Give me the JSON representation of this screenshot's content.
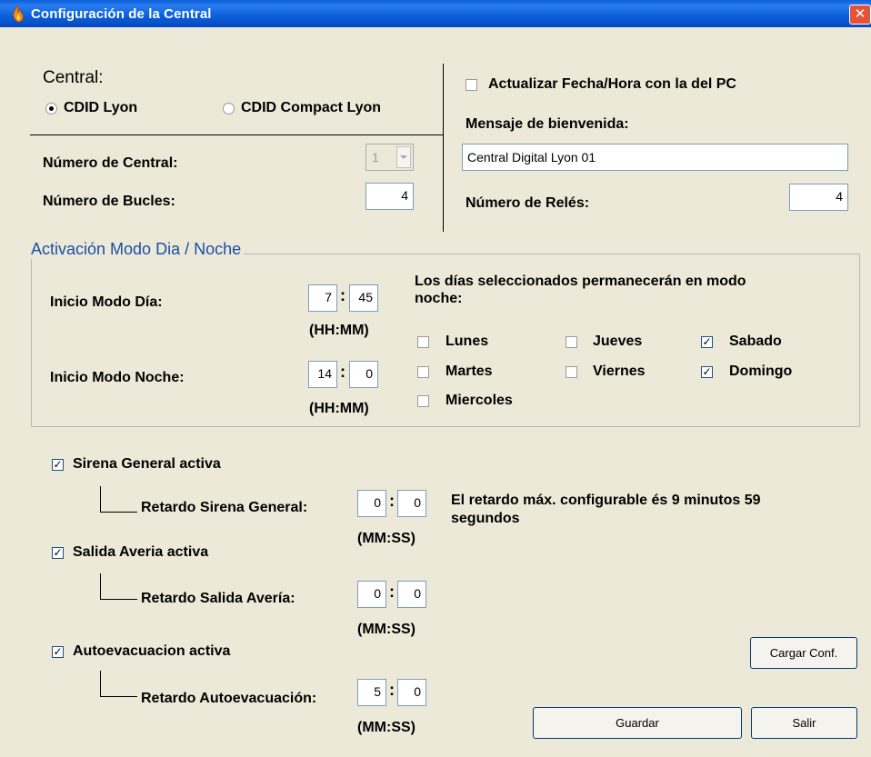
{
  "window": {
    "title": "Configuración de la Central"
  },
  "central": {
    "label": "Central:",
    "options": [
      "CDID Lyon",
      "CDID Compact Lyon"
    ],
    "selected": "CDID Lyon",
    "numero_central_label": "Número de Central:",
    "numero_central_value": "1",
    "numero_bucles_label": "Número de Bucles:",
    "numero_bucles_value": "4"
  },
  "right_panel": {
    "actualizar_label": "Actualizar Fecha/Hora con la del PC",
    "actualizar_checked": false,
    "mensaje_label": "Mensaje de bienvenida:",
    "mensaje_value": "Central Digital Lyon 01",
    "reles_label": "Número de Relés:",
    "reles_value": "4"
  },
  "dia_noche": {
    "group_title": "Activación Modo Dia / Noche",
    "inicio_dia_label": "Inicio Modo Día:",
    "dia_hh": "7",
    "dia_mm": "45",
    "inicio_noche_label": "Inicio Modo Noche:",
    "noche_hh": "14",
    "noche_mm": "0",
    "format_label": "(HH:MM)",
    "dias_info": "Los días seleccionados permanecerán en modo noche:",
    "dias_info_line1": "Los días seleccionados permanecerán en modo",
    "dias_info_line2": "noche:",
    "days": {
      "lunes": {
        "label": "Lunes",
        "checked": false
      },
      "martes": {
        "label": "Martes",
        "checked": false
      },
      "miercoles": {
        "label": "Miercoles",
        "checked": false
      },
      "jueves": {
        "label": "Jueves",
        "checked": false
      },
      "viernes": {
        "label": "Viernes",
        "checked": false
      },
      "sabado": {
        "label": "Sabado",
        "checked": true
      },
      "domingo": {
        "label": "Domingo",
        "checked": true
      }
    }
  },
  "sirena": {
    "label": "Sirena General activa",
    "checked": true,
    "retardo_label": "Retardo Sirena General:",
    "mm": "0",
    "ss": "0"
  },
  "averia": {
    "label": "Salida Averia activa",
    "checked": true,
    "retardo_label": "Retardo Salida Avería:",
    "mm": "0",
    "ss": "0"
  },
  "autoevac": {
    "label": "Autoevacuacion activa",
    "checked": true,
    "retardo_label": "Retardo Autoevacuación:",
    "mm": "5",
    "ss": "0"
  },
  "mmss_label": "(MM:SS)",
  "retardo_info_line1": "El retardo máx. configurable és 9 minutos 59",
  "retardo_info_line2": "segundos",
  "buttons": {
    "cargar": "Cargar Conf.",
    "guardar": "Guardar",
    "salir": "Salir"
  },
  "colors": {
    "titlebar": "#0a5fd8",
    "dialog_bg": "#ece9d8",
    "group_title": "#1b4fa5",
    "close": "#e3533b"
  },
  "icons": {
    "app": "fire-icon",
    "close": "close-icon"
  }
}
